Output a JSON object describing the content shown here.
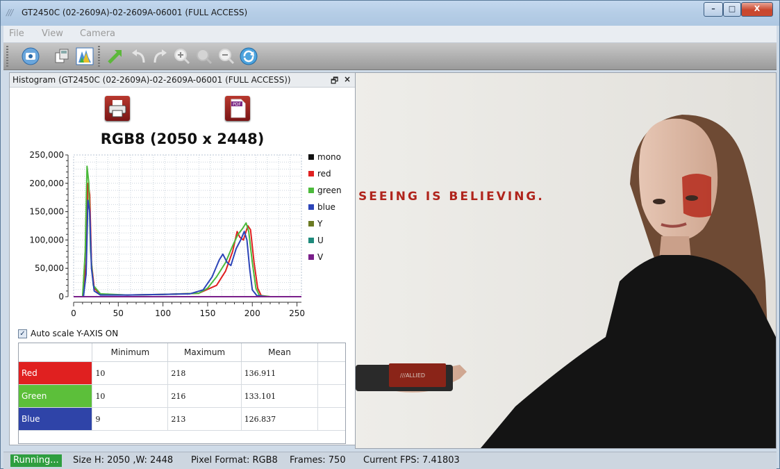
{
  "window": {
    "logo": "///",
    "title": "GT2450C (02-2609A)-02-2609A-06001 (FULL ACCESS)",
    "minimize": "–",
    "maximize": "□",
    "close": "X"
  },
  "menu": [
    "File",
    "View",
    "Camera"
  ],
  "histogram_panel": {
    "title": "Histogram   (GT2450C (02-2609A)-02-2609A-06001 (FULL ACCESS))",
    "float_icon": "🗗",
    "close_icon": "×",
    "pdf_badge": "PDF",
    "auto_scale_label": "Auto scale Y-AXIS ON",
    "auto_scale_checked": true
  },
  "chart_data": {
    "type": "line",
    "title": "RGB8 (2050 x 2448)",
    "xlim": [
      0,
      255
    ],
    "ylim": [
      0,
      250000
    ],
    "x_ticks": [
      "0",
      "50",
      "100",
      "150",
      "200",
      "250"
    ],
    "y_ticks": [
      "0",
      "50,000",
      "100,000",
      "150,000",
      "200,000",
      "250,000"
    ],
    "grid": true,
    "legend_placement": "right",
    "legend": [
      {
        "name": "mono",
        "color": "#111111"
      },
      {
        "name": "red",
        "color": "#e02020"
      },
      {
        "name": "green",
        "color": "#4cba3c"
      },
      {
        "name": "blue",
        "color": "#2c44b8"
      },
      {
        "name": "Y",
        "color": "#6b7a22"
      },
      {
        "name": "U",
        "color": "#1f8a7c"
      },
      {
        "name": "V",
        "color": "#7a1f8a"
      }
    ],
    "series": [
      {
        "name": "red",
        "color": "#e02020",
        "points": [
          [
            0,
            0
          ],
          [
            10,
            0
          ],
          [
            14,
            60000
          ],
          [
            16,
            200000
          ],
          [
            18,
            180000
          ],
          [
            20,
            60000
          ],
          [
            23,
            15000
          ],
          [
            30,
            4000
          ],
          [
            60,
            3000
          ],
          [
            100,
            4000
          ],
          [
            140,
            6000
          ],
          [
            160,
            20000
          ],
          [
            170,
            45000
          ],
          [
            178,
            80000
          ],
          [
            183,
            115000
          ],
          [
            186,
            105000
          ],
          [
            190,
            100000
          ],
          [
            195,
            125000
          ],
          [
            198,
            118000
          ],
          [
            202,
            60000
          ],
          [
            206,
            15000
          ],
          [
            210,
            2000
          ],
          [
            220,
            0
          ],
          [
            255,
            0
          ]
        ]
      },
      {
        "name": "green",
        "color": "#4cba3c",
        "points": [
          [
            0,
            0
          ],
          [
            10,
            0
          ],
          [
            13,
            80000
          ],
          [
            15,
            230000
          ],
          [
            17,
            200000
          ],
          [
            19,
            80000
          ],
          [
            22,
            20000
          ],
          [
            30,
            5000
          ],
          [
            60,
            3000
          ],
          [
            100,
            4000
          ],
          [
            140,
            6000
          ],
          [
            150,
            15000
          ],
          [
            160,
            35000
          ],
          [
            170,
            60000
          ],
          [
            178,
            90000
          ],
          [
            184,
            110000
          ],
          [
            189,
            120000
          ],
          [
            193,
            130000
          ],
          [
            196,
            115000
          ],
          [
            200,
            60000
          ],
          [
            204,
            15000
          ],
          [
            208,
            2000
          ],
          [
            220,
            0
          ],
          [
            255,
            0
          ]
        ]
      },
      {
        "name": "blue",
        "color": "#2c44b8",
        "points": [
          [
            0,
            0
          ],
          [
            11,
            0
          ],
          [
            14,
            40000
          ],
          [
            16,
            170000
          ],
          [
            18,
            150000
          ],
          [
            20,
            50000
          ],
          [
            23,
            10000
          ],
          [
            30,
            3000
          ],
          [
            60,
            3000
          ],
          [
            100,
            4000
          ],
          [
            130,
            5000
          ],
          [
            145,
            12000
          ],
          [
            155,
            35000
          ],
          [
            163,
            65000
          ],
          [
            167,
            75000
          ],
          [
            172,
            60000
          ],
          [
            176,
            55000
          ],
          [
            182,
            85000
          ],
          [
            187,
            100000
          ],
          [
            191,
            115000
          ],
          [
            194,
            100000
          ],
          [
            197,
            50000
          ],
          [
            200,
            12000
          ],
          [
            205,
            2000
          ],
          [
            215,
            0
          ],
          [
            255,
            0
          ]
        ]
      },
      {
        "name": "V",
        "color": "#7a1f8a",
        "points": [
          [
            0,
            0
          ],
          [
            255,
            0
          ]
        ]
      }
    ]
  },
  "stats": {
    "headers": [
      "",
      "Minimum",
      "Maximum",
      "Mean"
    ],
    "rows": [
      {
        "label": "Red",
        "color": "#e02020",
        "min": "10",
        "max": "218",
        "mean": "136.911"
      },
      {
        "label": "Green",
        "color": "#5cbf3a",
        "min": "10",
        "max": "216",
        "mean": "133.101"
      },
      {
        "label": "Blue",
        "color": "#2f44a8",
        "min": "9",
        "max": "213",
        "mean": "126.837"
      }
    ]
  },
  "image": {
    "headline": "SEEING IS BELIEVING.",
    "camera_brand": "///ALLIED"
  },
  "status": {
    "running": "Running...",
    "size": "Size H: 2050 ,W: 2448",
    "pixel_format": "Pixel Format: RGB8",
    "frames": "Frames: 750",
    "fps": "Current FPS: 7.41803"
  }
}
